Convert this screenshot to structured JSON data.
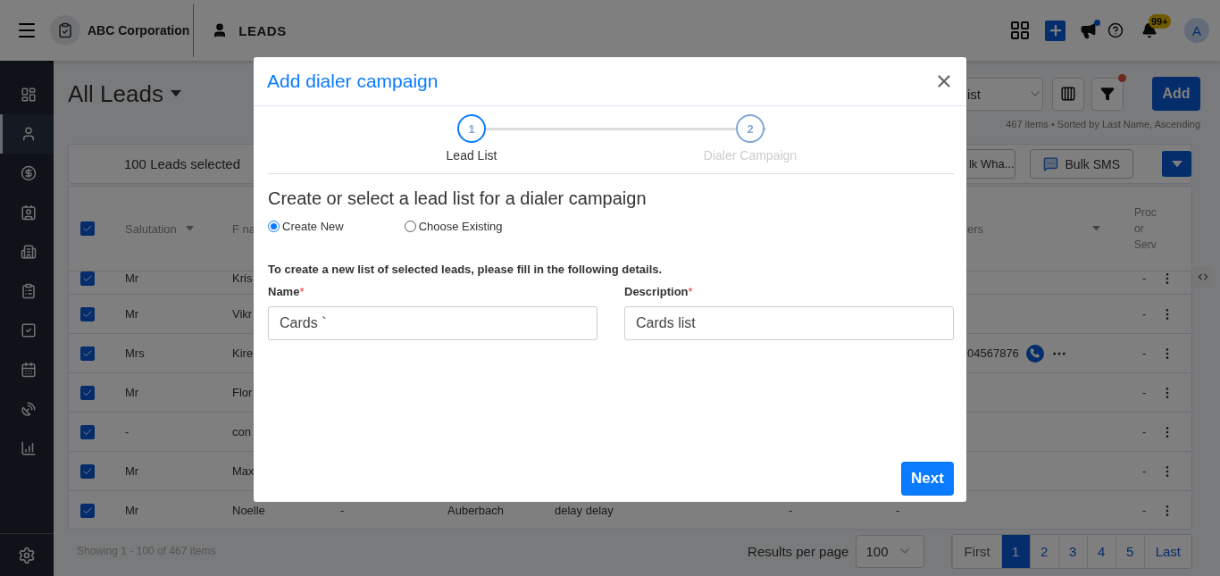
{
  "top_bar": {
    "company": "ABC Corporation",
    "module": "LEADS",
    "notification_count": "99+",
    "avatar_initial": "A"
  },
  "sidebar": {
    "items": [
      {
        "selected": false
      },
      {
        "selected": true
      },
      {
        "selected": false
      },
      {
        "selected": false
      },
      {
        "selected": false
      },
      {
        "selected": false
      },
      {
        "selected": false
      },
      {
        "selected": false
      },
      {
        "selected": false
      },
      {
        "selected": false
      }
    ]
  },
  "page": {
    "title": "All Leads",
    "view_select": "ist",
    "summary": "467 items • Sorted by Last Name, Ascending",
    "add_button": "Add",
    "filter_active": true
  },
  "bulk_bar": {
    "selection": "100 Leads selected",
    "buttons": [
      "lk Wha...",
      "Bulk SMS"
    ]
  },
  "table": {
    "all_checked": true,
    "columns": [
      "Salutation",
      "F na",
      "ers",
      "Proc or Serv"
    ],
    "rows": [
      {
        "checked": true,
        "salutation": "Mr",
        "first_name": "Kris",
        "product": "-"
      },
      {
        "checked": true,
        "salutation": "Mr",
        "first_name": "Vikr",
        "product": "-"
      },
      {
        "checked": true,
        "salutation": "Mrs",
        "first_name": "Kire",
        "phone": "04567876",
        "product": "-"
      },
      {
        "checked": true,
        "salutation": "Mr",
        "first_name": "Flor",
        "product": "-"
      },
      {
        "checked": true,
        "salutation": "-",
        "first_name": "con",
        "product": "-"
      },
      {
        "checked": true,
        "salutation": "Mr",
        "first_name": "Max",
        "product": "-"
      },
      {
        "checked": true,
        "salutation": "Mr",
        "first_name": "Noelle",
        "column_3": "-",
        "column_4": "Auberbach",
        "column_5": "delay delay",
        "column_6": "-",
        "column_7": "-",
        "product": "-"
      }
    ]
  },
  "footer": {
    "showing": "Showing 1 - 100 of 467 items",
    "per_page_label": "Results per page",
    "per_page": "100",
    "pages": [
      {
        "label": "First",
        "selected": false
      },
      {
        "label": "1",
        "selected": true
      },
      {
        "label": "2",
        "selected": false
      },
      {
        "label": "3",
        "selected": false
      },
      {
        "label": "4",
        "selected": false
      },
      {
        "label": "5",
        "selected": false
      },
      {
        "label": "Last",
        "selected": false
      }
    ]
  },
  "dialog": {
    "title": "Add dialer campaign",
    "steps": [
      {
        "number": "1",
        "label": "Lead List",
        "selected": true
      },
      {
        "number": "2",
        "label": "Dialer Campaign",
        "selected": false
      }
    ],
    "heading": "Create or select a lead list for a dialer campaign",
    "options": [
      {
        "label": "Create New",
        "selected": true
      },
      {
        "label": "Choose Existing",
        "selected": false
      }
    ],
    "instruction": "To create a new list of selected leads, please fill in the following details.",
    "fields": [
      {
        "label": "Name",
        "required": true,
        "required_mark": "*",
        "value": "Cards `"
      },
      {
        "label": "Description",
        "required": true,
        "required_mark": "*",
        "value": "Cards list"
      }
    ],
    "next_button": "Next"
  }
}
